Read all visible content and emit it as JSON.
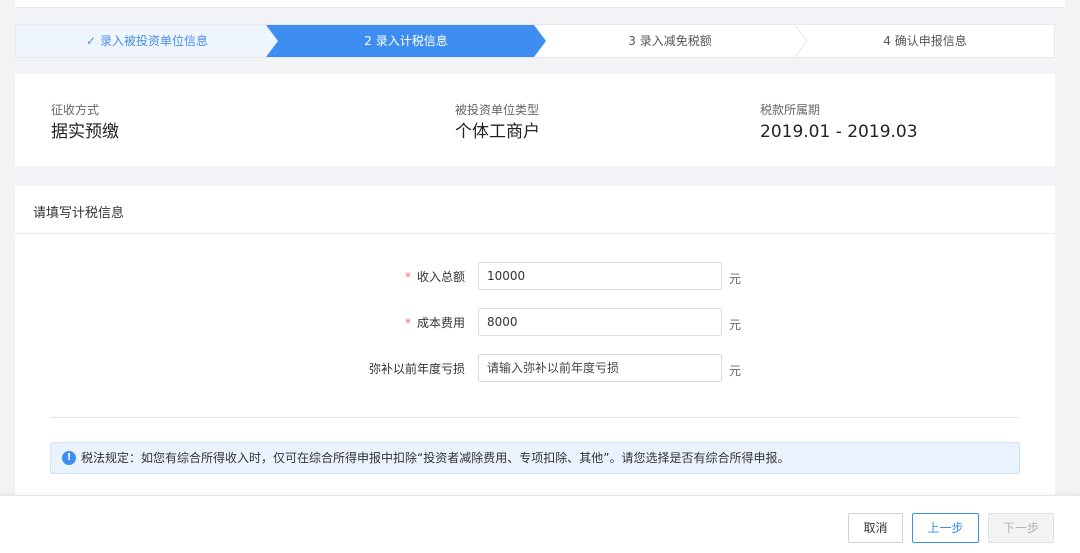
{
  "steps": [
    {
      "label": "录入被投资单位信息",
      "state": "done"
    },
    {
      "label": "2 录入计税信息",
      "state": "active"
    },
    {
      "label": "3 录入减免税额",
      "state": "pending"
    },
    {
      "label": "4 确认申报信息",
      "state": "pending"
    }
  ],
  "info": {
    "collection_method_label": "征收方式",
    "collection_method_value": "据实预缴",
    "entity_type_label": "被投资单位类型",
    "entity_type_value": "个体工商户",
    "period_label": "税款所属期",
    "period_value": "2019.01 - 2019.03"
  },
  "form": {
    "title": "请填写计税信息",
    "fields": [
      {
        "label": "收入总额",
        "required": true,
        "value": "10000",
        "placeholder": "",
        "unit": "元"
      },
      {
        "label": "成本费用",
        "required": true,
        "value": "8000",
        "placeholder": "",
        "unit": "元"
      },
      {
        "label": "弥补以前年度亏损",
        "required": false,
        "value": "",
        "placeholder": "请输入弥补以前年度亏损",
        "unit": "元"
      }
    ],
    "required_mark": "*",
    "notice_icon": "!",
    "notice": "税法规定：如您有综合所得收入时，仅可在综合所得申报中扣除“投资者减除费用、专项扣除、其他”。请您选择是否有综合所得申报。"
  },
  "footer": {
    "cancel_label": "取消",
    "prev_label": "上一步",
    "next_label": "下一步"
  },
  "colors": {
    "accent": "#3d8ef0",
    "done_step_bg": "#eef5fd",
    "required": "#f56c6c"
  }
}
